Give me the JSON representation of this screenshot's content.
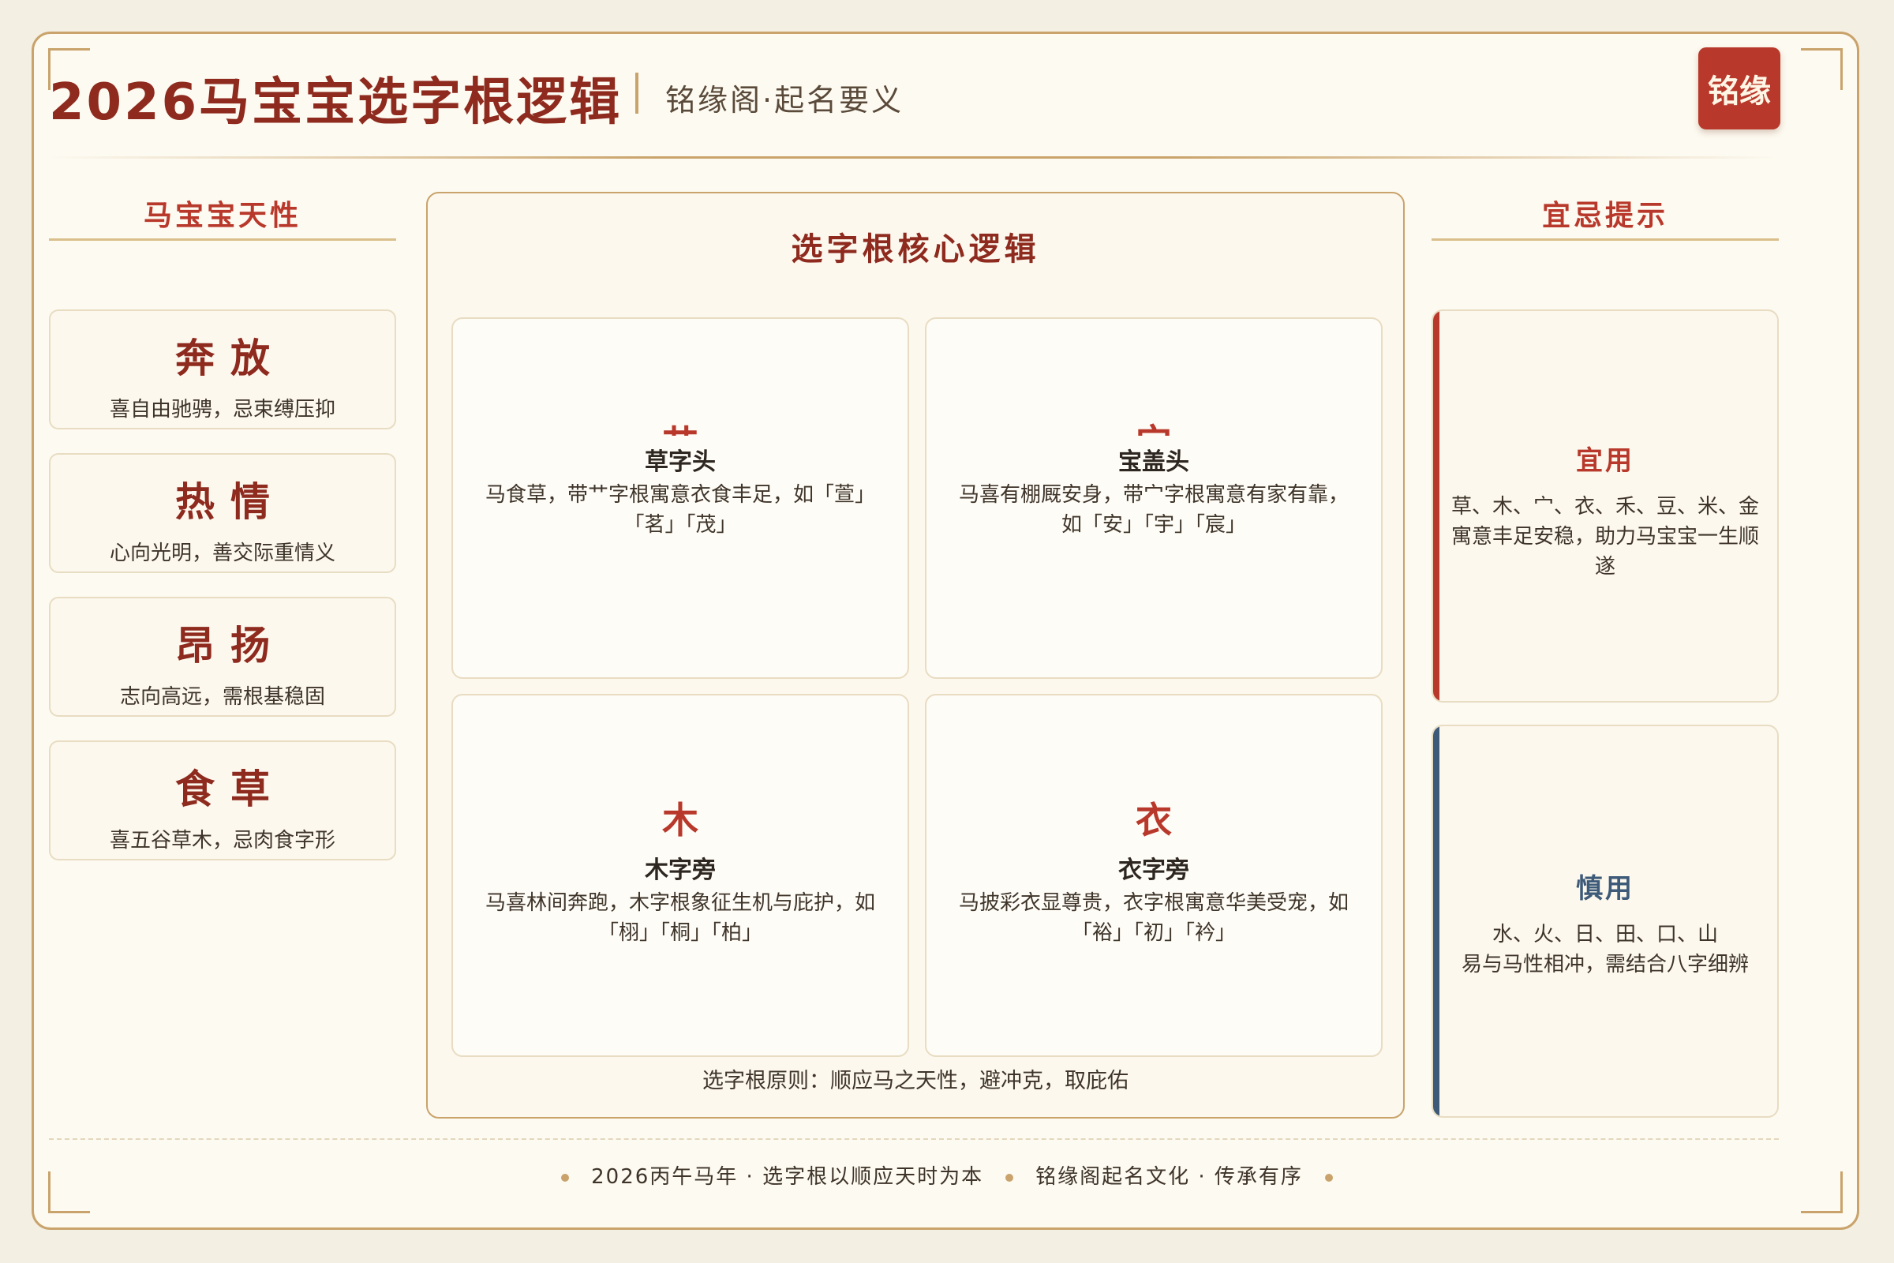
{
  "header": {
    "title": "2026马宝宝选字根逻辑",
    "subtitle": "铭缘阁·起名要义",
    "logo": "铭缘"
  },
  "left": {
    "heading": "马宝宝天性",
    "traits": [
      {
        "title": "奔放",
        "desc": "喜自由驰骋，忌束缚压抑"
      },
      {
        "title": "热情",
        "desc": "心向光明，善交际重情义"
      },
      {
        "title": "昂扬",
        "desc": "志向高远，需根基稳固"
      },
      {
        "title": "食草",
        "desc": "喜五谷草木，忌肉食字形"
      }
    ]
  },
  "center": {
    "heading": "选字根核心逻辑",
    "radicals": [
      {
        "icon": "艹",
        "name": "草字头",
        "desc": "马食草，带艹字根寓意衣食丰足，如「萱」「茗」「茂」"
      },
      {
        "icon": "宀",
        "name": "宝盖头",
        "desc": "马喜有棚厩安身，带宀字根寓意有家有靠，如「安」「宇」「宸」"
      },
      {
        "icon": "木",
        "name": "木字旁",
        "desc": "马喜林间奔跑，木字根象征生机与庇护，如「栩」「桐」「柏」"
      },
      {
        "icon": "衣",
        "name": "衣字旁",
        "desc": "马披彩衣显尊贵，衣字根寓意华美受宠，如「裕」「初」「衿」"
      }
    ],
    "principle": "选字根原则：顺应马之天性，避冲克，取庇佑"
  },
  "right": {
    "heading": "宜忌提示",
    "suitable": {
      "title": "宜用",
      "body": "草、木、宀、衣、禾、豆、米、金寓意丰足安稳，助力马宝宝一生顺遂",
      "color": "#b8392b"
    },
    "caution": {
      "title": "慎用",
      "line1": "水、火、日、田、口、山",
      "line2": "易与马性相冲，需结合八字细辨",
      "color": "#3d5a78"
    }
  },
  "footer": {
    "left": "2026丙午马年 · 选字根以顺应天时为本",
    "right": "铭缘阁起名文化 · 传承有序"
  }
}
